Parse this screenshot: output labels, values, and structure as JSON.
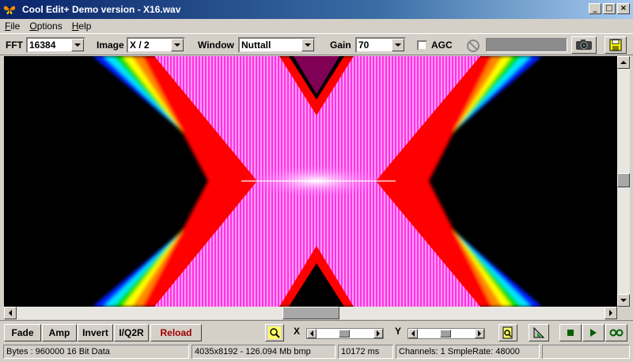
{
  "window": {
    "title": "Cool Edit+  Demo version - X16.wav",
    "controls": [
      "minimize",
      "maximize",
      "close"
    ]
  },
  "menu": {
    "items": [
      {
        "label": "File",
        "mnemonic": "F",
        "rest": "ile"
      },
      {
        "label": "Options",
        "mnemonic": "O",
        "rest": "ptions"
      },
      {
        "label": "Help",
        "mnemonic": "H",
        "rest": "elp"
      }
    ]
  },
  "toolbar": {
    "fft_label": "FFT",
    "fft_value": "16384",
    "image_label": "Image",
    "image_value": "X / 2",
    "window_label": "Window",
    "window_value": "Nuttall",
    "gain_label": "Gain",
    "gain_value": "70",
    "agc_label": "AGC",
    "agc_checked": false,
    "icons": {
      "stop": "no-entry-icon",
      "camera": "camera-icon",
      "save": "floppy-disk-icon"
    }
  },
  "bottom": {
    "buttons": [
      "Fade",
      "Amp",
      "Invert",
      "I/Q2R",
      "Reload"
    ],
    "x_label": "X",
    "y_label": "Y",
    "icons": {
      "zoom": "zoom-icon",
      "doc_zoom": "document-zoom-icon",
      "measure": "measure-icon",
      "stop": "stop-icon",
      "play": "play-icon",
      "loop": "loop-icon"
    }
  },
  "status": {
    "bytes": "Bytes : 960000 16 Bit Data",
    "image": "4035x8192 - 126.094 Mb bmp",
    "duration": "10172 ms",
    "channels": "Channels: 1  SmpleRate: 48000"
  },
  "colors": {
    "title_gradient_start": "#0a246a",
    "title_gradient_end": "#a6caf0",
    "reload_text": "#a00000",
    "spectrogram_core": "#ff00ff"
  }
}
